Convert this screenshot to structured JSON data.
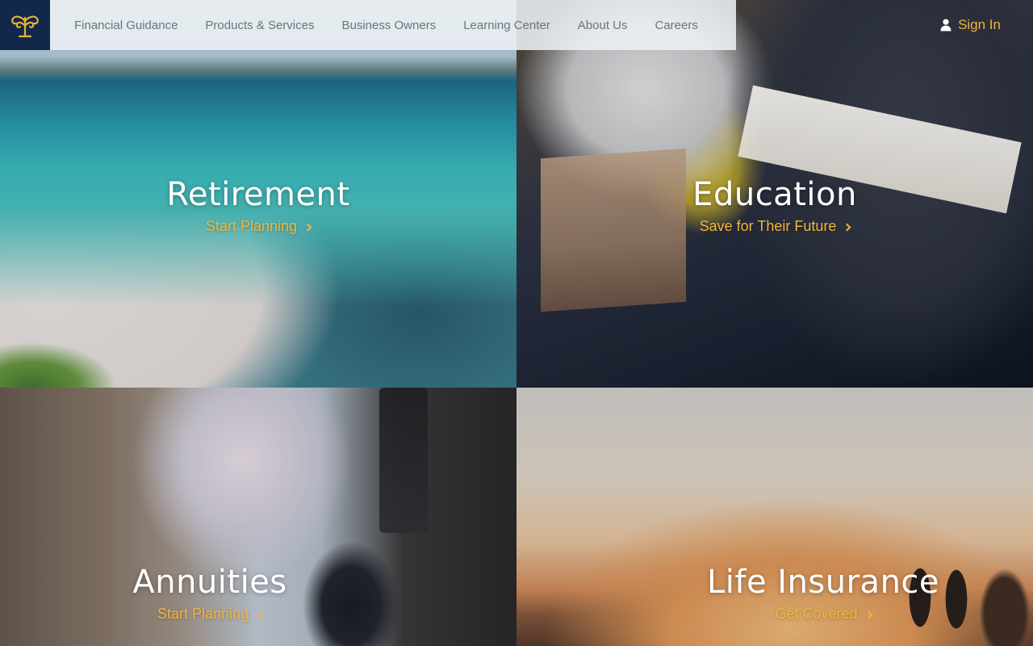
{
  "brand": {
    "logo_icon": "capital-leaf-logo",
    "accent": "#f2b43a",
    "navy": "#12284a"
  },
  "nav": {
    "items": [
      "Financial Guidance",
      "Products & Services",
      "Business Owners",
      "Learning Center",
      "About Us",
      "Careers"
    ],
    "sign_in": "Sign In",
    "sign_in_icon": "user-icon"
  },
  "tiles": [
    {
      "title": "Retirement",
      "link": "Start Planning"
    },
    {
      "title": "Education",
      "link": "Save for Their Future"
    },
    {
      "title": "Annuities",
      "link": "Start Planning"
    },
    {
      "title": "Life Insurance",
      "link": "Get Covered"
    }
  ]
}
